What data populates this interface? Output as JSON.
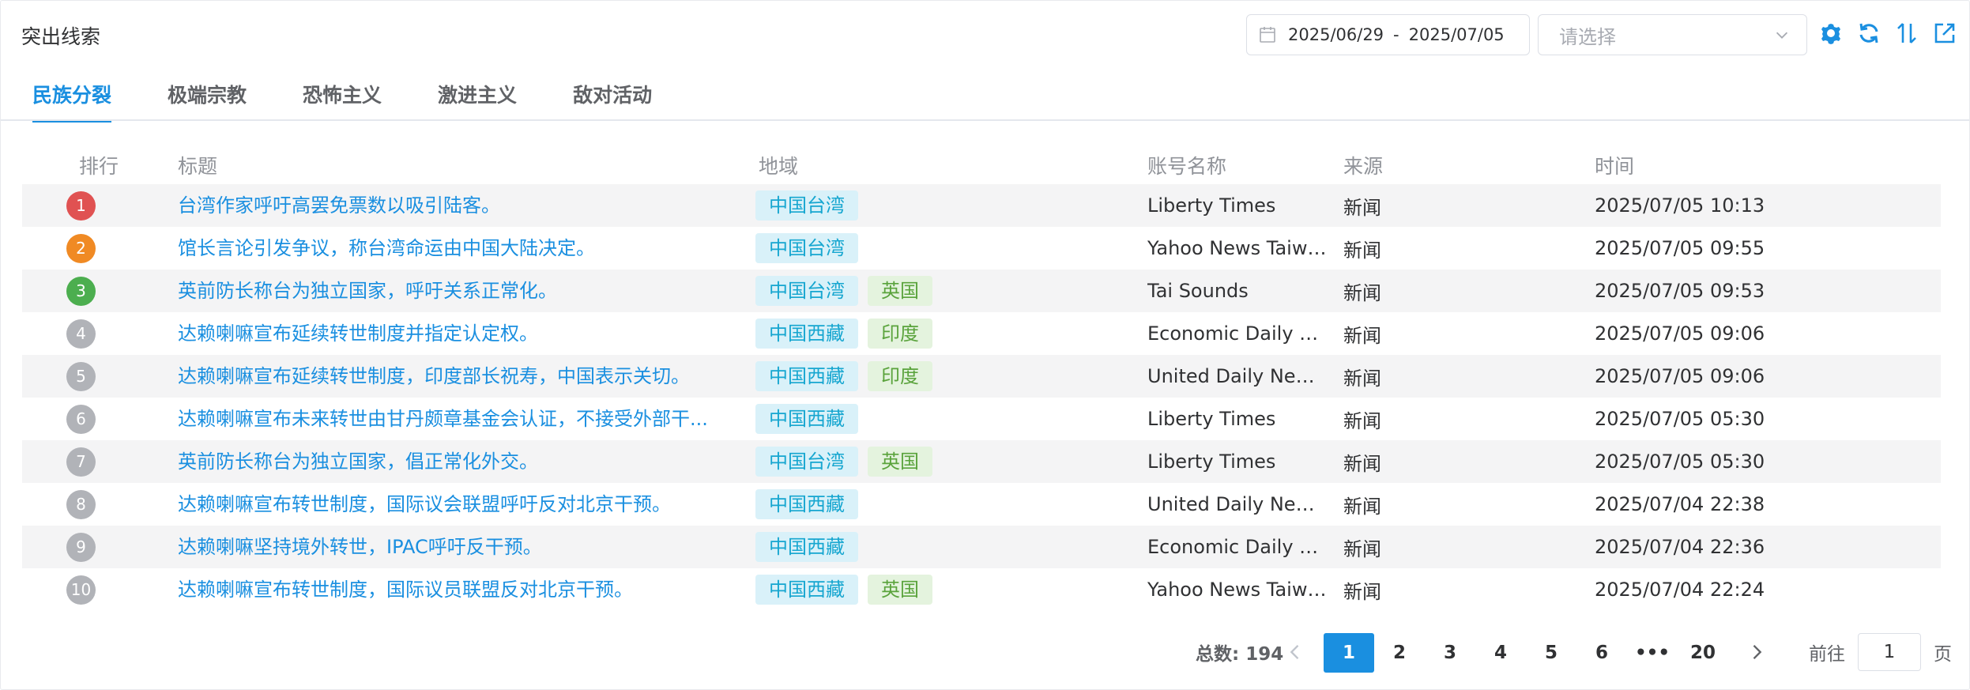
{
  "header": {
    "title": "突出线索",
    "date_start": "2025/06/29",
    "date_separator": "-",
    "date_end": "2025/07/05",
    "select_placeholder": "请选择"
  },
  "icons": {
    "calendar": "calendar-icon",
    "chevron": "chevron-down-icon",
    "settings": "gear-icon",
    "refresh": "refresh-icon",
    "sort": "sort-icon",
    "export": "export-icon"
  },
  "tabs": [
    {
      "label": "民族分裂",
      "active": true
    },
    {
      "label": "极端宗教",
      "active": false
    },
    {
      "label": "恐怖主义",
      "active": false
    },
    {
      "label": "激进主义",
      "active": false
    },
    {
      "label": "敌对活动",
      "active": false
    }
  ],
  "columns": {
    "rank": "排行",
    "title": "标题",
    "region": "地域",
    "account": "账号名称",
    "source": "来源",
    "time": "时间"
  },
  "rows": [
    {
      "rank": "1",
      "rank_color": "#e05252",
      "title": "台湾作家呼吁高罢免票数以吸引陆客。",
      "tags": [
        {
          "text": "中国台湾",
          "kind": "blue"
        }
      ],
      "account": "Liberty Times",
      "source": "新闻",
      "time": "2025/07/05 10:13"
    },
    {
      "rank": "2",
      "rank_color": "#f08a24",
      "title": "馆长言论引发争议，称台湾命运由中国大陆决定。",
      "tags": [
        {
          "text": "中国台湾",
          "kind": "blue"
        }
      ],
      "account": "Yahoo News Taiwan",
      "source": "新闻",
      "time": "2025/07/05 09:55"
    },
    {
      "rank": "3",
      "rank_color": "#4cae4f",
      "title": "英前防长称台为独立国家，呼吁关系正常化。",
      "tags": [
        {
          "text": "中国台湾",
          "kind": "blue"
        },
        {
          "text": "英国",
          "kind": "green"
        }
      ],
      "account": "Tai Sounds",
      "source": "新闻",
      "time": "2025/07/05 09:53"
    },
    {
      "rank": "4",
      "rank_color": "#b1b3b8",
      "title": "达赖喇嘛宣布延续转世制度并指定认定权。",
      "tags": [
        {
          "text": "中国西藏",
          "kind": "blue"
        },
        {
          "text": "印度",
          "kind": "green"
        }
      ],
      "account": "Economic Daily N...",
      "source": "新闻",
      "time": "2025/07/05 09:06"
    },
    {
      "rank": "5",
      "rank_color": "#b1b3b8",
      "title": "达赖喇嘛宣布延续转世制度，印度部长祝寿，中国表示关切。",
      "tags": [
        {
          "text": "中国西藏",
          "kind": "blue"
        },
        {
          "text": "印度",
          "kind": "green"
        }
      ],
      "account": "United Daily News...",
      "source": "新闻",
      "time": "2025/07/05 09:06"
    },
    {
      "rank": "6",
      "rank_color": "#b1b3b8",
      "title": "达赖喇嘛宣布未来转世由甘丹颇章基金会认证，不接受外部干...",
      "tags": [
        {
          "text": "中国西藏",
          "kind": "blue"
        }
      ],
      "account": "Liberty Times",
      "source": "新闻",
      "time": "2025/07/05 05:30"
    },
    {
      "rank": "7",
      "rank_color": "#b1b3b8",
      "title": "英前防长称台为独立国家，倡正常化外交。",
      "tags": [
        {
          "text": "中国台湾",
          "kind": "blue"
        },
        {
          "text": "英国",
          "kind": "green"
        }
      ],
      "account": "Liberty Times",
      "source": "新闻",
      "time": "2025/07/05 05:30"
    },
    {
      "rank": "8",
      "rank_color": "#b1b3b8",
      "title": "达赖喇嘛宣布转世制度，国际议会联盟呼吁反对北京干预。",
      "tags": [
        {
          "text": "中国西藏",
          "kind": "blue"
        }
      ],
      "account": "United Daily News...",
      "source": "新闻",
      "time": "2025/07/04 22:38"
    },
    {
      "rank": "9",
      "rank_color": "#b1b3b8",
      "title": "达赖喇嘛坚持境外转世，IPAC呼吁反干预。",
      "tags": [
        {
          "text": "中国西藏",
          "kind": "blue"
        }
      ],
      "account": "Economic Daily N...",
      "source": "新闻",
      "time": "2025/07/04 22:36"
    },
    {
      "rank": "10",
      "rank_color": "#b1b3b8",
      "title": "达赖喇嘛宣布转世制度，国际议员联盟反对北京干预。",
      "tags": [
        {
          "text": "中国西藏",
          "kind": "blue"
        },
        {
          "text": "英国",
          "kind": "green"
        }
      ],
      "account": "Yahoo News Taiwan",
      "source": "新闻",
      "time": "2025/07/04 22:24"
    }
  ],
  "pagination": {
    "total_label": "总数: 194",
    "pages": [
      "1",
      "2",
      "3",
      "4",
      "5",
      "6",
      "•••",
      "20"
    ],
    "current": "1",
    "goto_prefix": "前往",
    "goto_value": "1",
    "goto_suffix": "页"
  },
  "colors": {
    "accent": "#1a8fe0",
    "tag_blue_bg": "#d9f1f9",
    "tag_green_bg": "#e4f3de"
  }
}
